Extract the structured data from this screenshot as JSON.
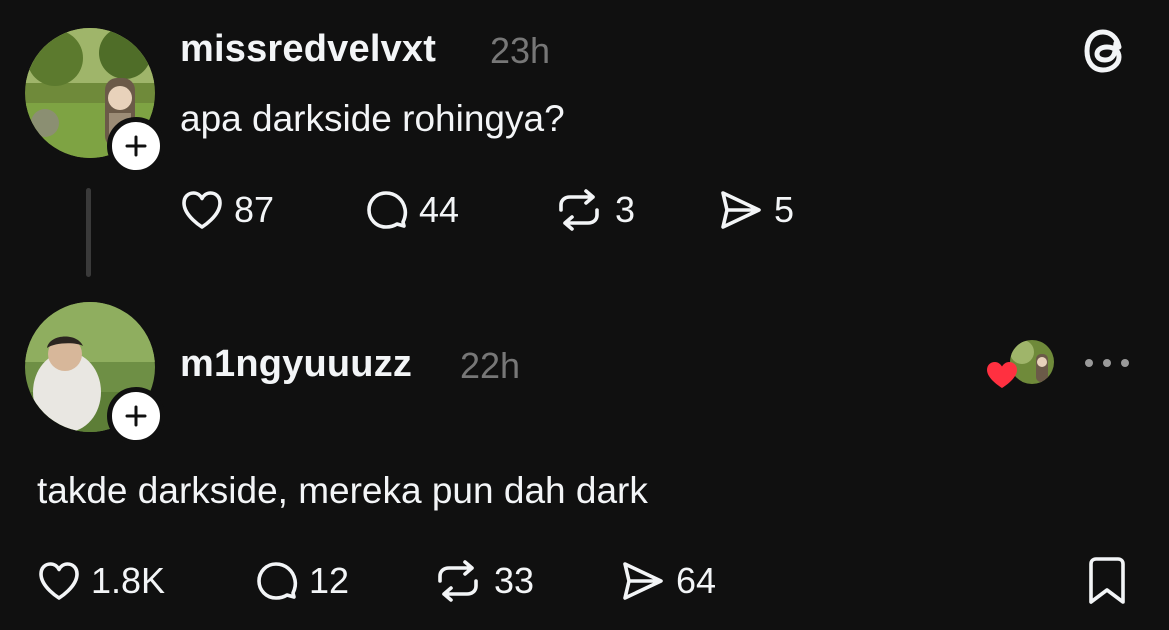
{
  "post": {
    "username": "missredvelvxt",
    "time": "23h",
    "text": "apa darkside rohingya?",
    "likes": "87",
    "replies": "44",
    "reposts": "3",
    "shares": "5"
  },
  "reply": {
    "username": "m1ngyuuuzz",
    "time": "22h",
    "text": "takde darkside, mereka pun dah dark",
    "likes": "1.8K",
    "replies": "12",
    "reposts": "33",
    "shares": "64"
  },
  "icons": {
    "app_logo": "threads-logo-icon",
    "like": "heart-icon",
    "reply": "comment-icon",
    "repost": "repost-icon",
    "share": "send-icon",
    "save": "bookmark-icon",
    "more": "more-icon",
    "follow": "plus-icon",
    "liked_by_author": "red-heart-icon"
  },
  "colors": {
    "background": "#101010",
    "text": "#f3f5f7",
    "secondary": "#777777",
    "liked_heart": "#ff3040"
  }
}
